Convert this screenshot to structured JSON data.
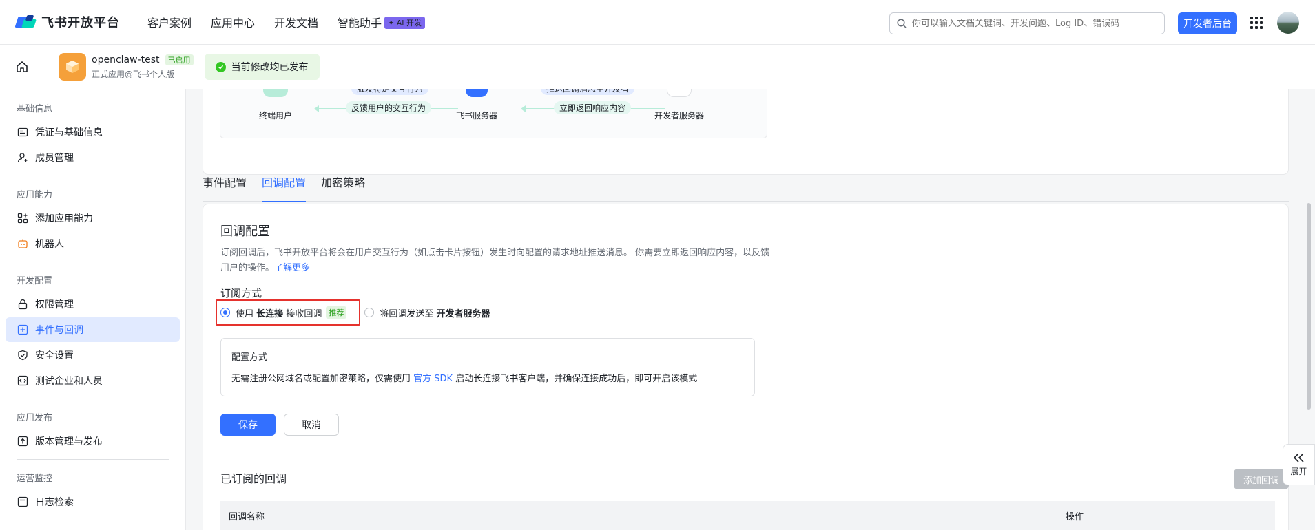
{
  "header": {
    "brand": "飞书开放平台",
    "nav": [
      "客户案例",
      "应用中心",
      "开发文档",
      "智能助手"
    ],
    "ai_badge": "✦ AI 开发",
    "search_placeholder": "你可以输入文档关键词、开发问题、Log ID、错误码",
    "dev_console": "开发者后台"
  },
  "app": {
    "name": "openclaw-test",
    "status": "已启用",
    "subtitle": "正式应用@飞书个人版",
    "publish_state": "当前修改均已发布"
  },
  "sidebar": {
    "groups": [
      {
        "title": "基础信息",
        "items": [
          "凭证与基础信息",
          "成员管理"
        ]
      },
      {
        "title": "应用能力",
        "items": [
          "添加应用能力",
          "机器人"
        ]
      },
      {
        "title": "开发配置",
        "items": [
          "权限管理",
          "事件与回调",
          "安全设置",
          "测试企业和人员"
        ]
      },
      {
        "title": "应用发布",
        "items": [
          "版本管理与发布"
        ]
      },
      {
        "title": "运营监控",
        "items": [
          "日志检索"
        ]
      }
    ],
    "active": "事件与回调"
  },
  "diagram": {
    "nodes": [
      "终端用户",
      "飞书服务器",
      "开发者服务器"
    ],
    "labels_top": [
      "触发特定交互行为",
      "推送回调消息至开发者"
    ],
    "labels_bottom": [
      "反馈用户的交互行为",
      "立即返回响应内容"
    ]
  },
  "tabs": [
    "事件配置",
    "回调配置",
    "加密策略"
  ],
  "active_tab": "回调配置",
  "callback": {
    "title": "回调配置",
    "desc_line1": "订阅回调后，飞书开放平台将会在用户交互行为（如点击卡片按钮）发生时向配置的请求地址推送消息。 你需要立即返回响应内",
    "desc_line2": "容，以反馈用户的操作。",
    "learn_more": "了解更多",
    "sub_method_title": "订阅方式",
    "option1_prefix": "使用",
    "option1_bold": "长连接",
    "option1_suffix": "接收回调",
    "option1_tag": "推荐",
    "option2_prefix": "将回调发送至",
    "option2_bold": "开发者服务器",
    "mode_title": "配置方式",
    "mode_desc_prefix": "无需注册公网域名或配置加密策略，仅需使用",
    "mode_desc_link": "官方 SDK",
    "mode_desc_suffix": "启动长连接飞书客户端，并确保连接成功后，即可开启该模式",
    "save": "保存",
    "cancel": "取消",
    "subscribed_title": "已订阅的回调",
    "add_button": "添加回调",
    "table_columns": [
      "回调名称",
      "操作"
    ]
  },
  "expand_label": "展开",
  "colors": {
    "primary": "#3370ff",
    "highlight": "#e5322d",
    "success": "#34c724"
  }
}
